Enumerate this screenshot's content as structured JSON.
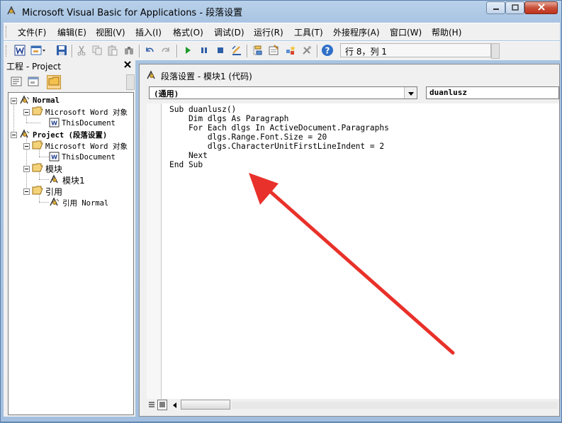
{
  "window": {
    "title": "Microsoft Visual Basic for Applications - 段落设置"
  },
  "menu": {
    "items": [
      "文件(F)",
      "编辑(E)",
      "视图(V)",
      "插入(I)",
      "格式(O)",
      "调试(D)",
      "运行(R)",
      "工具(T)",
      "外接程序(A)",
      "窗口(W)",
      "帮助(H)"
    ]
  },
  "toolbar": {
    "position_text": "行 8，列 1"
  },
  "project": {
    "title": "工程 - Project",
    "tree": {
      "normal": "Normal",
      "normal_word_objects": "Microsoft Word 对象",
      "normal_thisdocument": "ThisDocument",
      "project": "Project (段落设置)",
      "project_word_objects": "Microsoft Word 对象",
      "project_thisdocument": "ThisDocument",
      "modules_folder": "模块",
      "module1": "模块1",
      "references_folder": "引用",
      "reference_normal": "引用 Normal"
    }
  },
  "code": {
    "caption": "段落设置 - 模块1 (代码)",
    "object_combo": "(通用)",
    "procedure_combo": "duanlusz",
    "lines": [
      "Sub duanlusz()",
      "    Dim dlgs As Paragraph",
      "    For Each dlgs In ActiveDocument.Paragraphs",
      "        dlgs.Range.Font.Size = 20",
      "        dlgs.CharacterUnitFirstLineIndent = 2",
      "    Next",
      "End Sub"
    ]
  },
  "colors": {
    "annotation_arrow": "#e8312a",
    "title_bar": "#b9d1ea"
  }
}
